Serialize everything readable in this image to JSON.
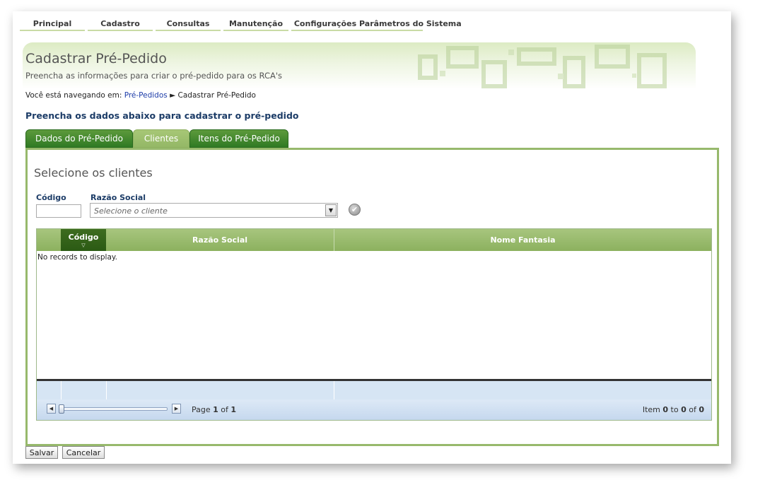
{
  "menu": {
    "items": [
      {
        "label": "Principal"
      },
      {
        "label": "Cadastro"
      },
      {
        "label": "Consultas"
      },
      {
        "label": "Manutenção"
      },
      {
        "label": "Configurações"
      },
      {
        "label": "Parâmetros do Sistema"
      }
    ]
  },
  "header": {
    "title": "Cadastrar Pré-Pedido",
    "subtitle": "Preencha as informações para criar o pré-pedido para os RCA's"
  },
  "breadcrumb": {
    "prefix": "Você está navegando em:",
    "link": "Pré-Pedidos",
    "separator": "►",
    "current": "Cadastrar Pré-Pedido"
  },
  "section_heading": "Preencha os dados abaixo para cadastrar o pré-pedido",
  "tabs": [
    {
      "label": "Dados do Pré-Pedido",
      "active": false
    },
    {
      "label": "Clientes",
      "active": true
    },
    {
      "label": "Itens do Pré-Pedido",
      "active": false
    }
  ],
  "panel": {
    "title": "Selecione os clientes",
    "codigo_label": "Código",
    "razao_label": "Razão Social",
    "codigo_value": "",
    "razao_placeholder": "Selecione o cliente"
  },
  "grid": {
    "columns": [
      "",
      "Código",
      "Razão Social",
      "Nome Fantasia"
    ],
    "sorted_column": "Código",
    "empty_message": "No records to display.",
    "pager": {
      "page_prefix": "Page",
      "page": "1",
      "of": "of",
      "total_pages": "1",
      "item_prefix": "Item",
      "item_from": "0",
      "to": "to",
      "item_to": "0",
      "of2": "of",
      "item_total": "0"
    }
  },
  "actions": {
    "save_label": "Salvar",
    "cancel_label": "Cancelar"
  },
  "colors": {
    "tab_inactive": "#2f7a24",
    "tab_active": "#a7c776",
    "heading": "#1c3c67",
    "link": "#1d3ca8"
  }
}
